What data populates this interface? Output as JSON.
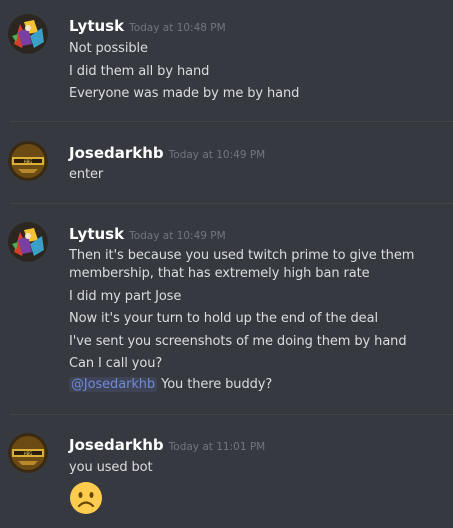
{
  "colors": {
    "background": "#36393f",
    "username": "#ffffff",
    "timestamp": "#72767d",
    "message_text": "#dcddde",
    "mention_text": "#7289da",
    "divider": "#42454a"
  },
  "messages": [
    {
      "author": "Lytusk",
      "timestamp": "Today at 10:48 PM",
      "avatar_icon": "lytusk-avatar-icon",
      "lines": [
        "Not possible",
        "I did them all by hand",
        "Everyone was made by me by hand"
      ]
    },
    {
      "author": "Josedarkhb",
      "timestamp": "Today at 10:49 PM",
      "avatar_icon": "josedarkhb-avatar-icon",
      "lines": [
        "enter"
      ]
    },
    {
      "author": "Lytusk",
      "timestamp": "Today at 10:49 PM",
      "avatar_icon": "lytusk-avatar-icon",
      "lines": [
        "Then it's because you used twitch prime to give them",
        "membership, that has extremely high ban rate",
        "I did my part Jose",
        "Now it's your turn to hold up the end of the deal",
        "I've sent you screenshots of me doing them by hand",
        "Can I call you?"
      ],
      "mention": "@Josedarkhb",
      "mention_suffix": "You there buddy?"
    },
    {
      "author": "Josedarkhb",
      "timestamp": "Today at 11:01 PM",
      "avatar_icon": "josedarkhb-avatar-icon",
      "lines": [
        "you used bot"
      ],
      "emoji": "frowning-face-emoji"
    }
  ]
}
